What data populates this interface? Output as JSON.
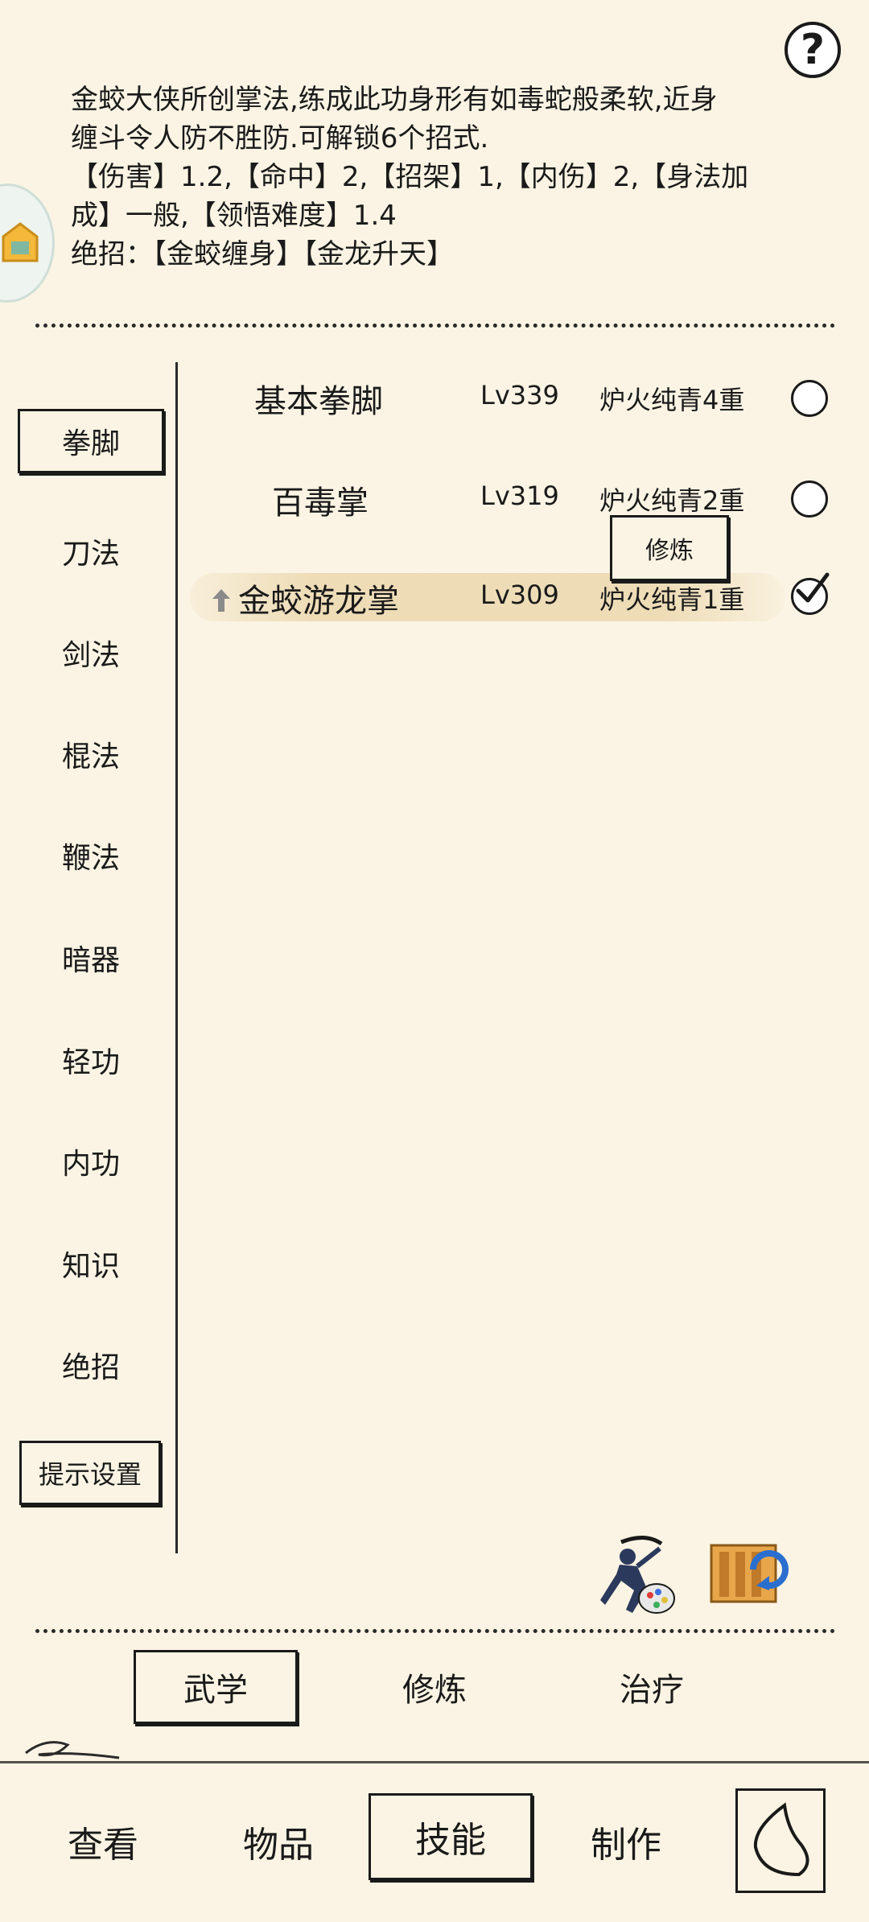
{
  "help_label": "?",
  "description": {
    "line1": "金蛟大侠所创掌法,练成此功身形有如毒蛇般柔软,近身",
    "line2": "缠斗令人防不胜防.可解锁6个招式.",
    "line3": "【伤害】1.2,【命中】2,【招架】1,【内伤】2,【身法加",
    "line4": "成】一般,【领悟难度】1.4",
    "line5": "绝招：【金蛟缠身】【金龙升天】"
  },
  "categories": [
    {
      "label": "拳脚",
      "active": true
    },
    {
      "label": "刀法"
    },
    {
      "label": "剑法"
    },
    {
      "label": "棍法"
    },
    {
      "label": "鞭法"
    },
    {
      "label": "暗器"
    },
    {
      "label": "轻功"
    },
    {
      "label": "内功"
    },
    {
      "label": "知识"
    },
    {
      "label": "绝招"
    }
  ],
  "hint_settings_label": "提示设置",
  "skills": [
    {
      "name": "基本拳脚",
      "level": "Lv339",
      "stage": "炉火纯青4重",
      "selected": false
    },
    {
      "name": "百毒掌",
      "level": "Lv319",
      "stage": "炉火纯青2重",
      "selected": false
    },
    {
      "name": "金蛟游龙掌",
      "level": "Lv309",
      "stage": "炉火纯青1重",
      "selected": true
    }
  ],
  "train_popup_label": "修炼",
  "tabs": [
    {
      "label": "武学",
      "active": true
    },
    {
      "label": "修炼"
    },
    {
      "label": "治疗"
    }
  ],
  "nav": [
    {
      "label": "查看"
    },
    {
      "label": "物品"
    },
    {
      "label": "技能",
      "active": true
    },
    {
      "label": "制作"
    }
  ]
}
